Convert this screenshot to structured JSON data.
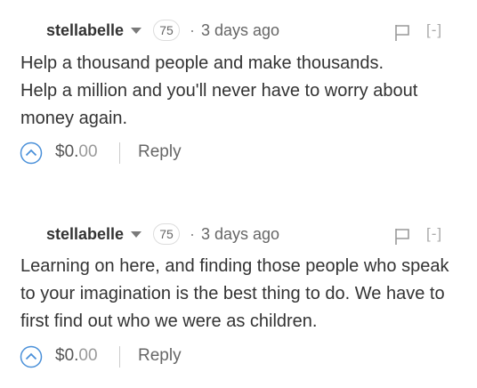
{
  "comments": [
    {
      "author": "stellabelle",
      "reputation": "75",
      "separator": "·",
      "time": "3 days ago",
      "collapse_label": "[-]",
      "body_lines": [
        "Help a thousand people and make thousands.",
        "Help a million and you'll never have to worry about money again."
      ],
      "payout_whole": "$0.",
      "payout_cents": "00",
      "reply_label": "Reply"
    },
    {
      "author": "stellabelle",
      "reputation": "75",
      "separator": "·",
      "time": "3 days ago",
      "collapse_label": "[-]",
      "body_lines": [
        "Learning on here, and finding those people who speak to your imagination is the best thing to do. We have to first find out who we were as children."
      ],
      "payout_whole": "$0.",
      "payout_cents": "00",
      "reply_label": "Reply"
    }
  ],
  "colors": {
    "text": "#333333",
    "muted": "#666666",
    "accent_vote": "#4a90d9"
  },
  "icons": {
    "dropdown": "caret-down-icon",
    "flag": "flag-icon",
    "upvote": "upvote-chevron-icon"
  }
}
